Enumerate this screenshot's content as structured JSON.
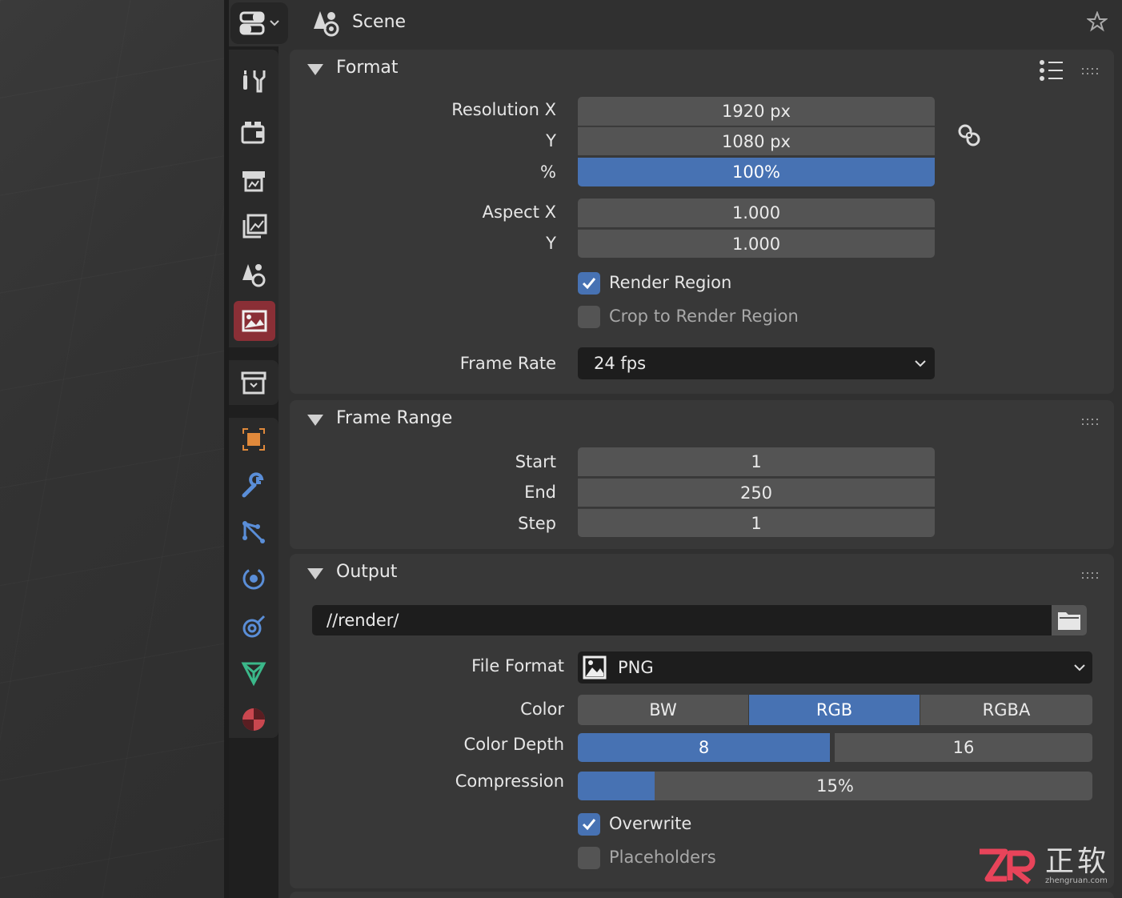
{
  "header": {
    "scene_label": "Scene"
  },
  "format_panel": {
    "title": "Format",
    "resolution_x_label": "Resolution X",
    "resolution_x_value": "1920 px",
    "resolution_y_label": "Y",
    "resolution_y_value": "1080 px",
    "percent_label": "%",
    "percent_value": "100%",
    "aspect_x_label": "Aspect X",
    "aspect_x_value": "1.000",
    "aspect_y_label": "Y",
    "aspect_y_value": "1.000",
    "render_region_label": "Render Region",
    "render_region_checked": true,
    "crop_label": "Crop to Render Region",
    "crop_checked": false,
    "frame_rate_label": "Frame Rate",
    "frame_rate_value": "24 fps"
  },
  "frame_range_panel": {
    "title": "Frame Range",
    "start_label": "Start",
    "start_value": "1",
    "end_label": "End",
    "end_value": "250",
    "step_label": "Step",
    "step_value": "1"
  },
  "output_panel": {
    "title": "Output",
    "path_value": "//render/",
    "file_format_label": "File Format",
    "file_format_value": "PNG",
    "color_label": "Color",
    "color_options": [
      "BW",
      "RGB",
      "RGBA"
    ],
    "color_selected": "RGB",
    "color_depth_label": "Color Depth",
    "color_depth_options": [
      "8",
      "16"
    ],
    "color_depth_selected": "8",
    "compression_label": "Compression",
    "compression_value": "15%",
    "compression_fraction": 0.15,
    "overwrite_label": "Overwrite",
    "overwrite_checked": true,
    "placeholders_label": "Placeholders",
    "placeholders_checked": false
  },
  "watermark": {
    "brand": "正软",
    "site": "zhengruan.com"
  },
  "colors": {
    "accent_blue": "#4772b3",
    "active_tab": "#8a2f36",
    "panel_bg": "#383838",
    "field_bg": "#545454"
  }
}
